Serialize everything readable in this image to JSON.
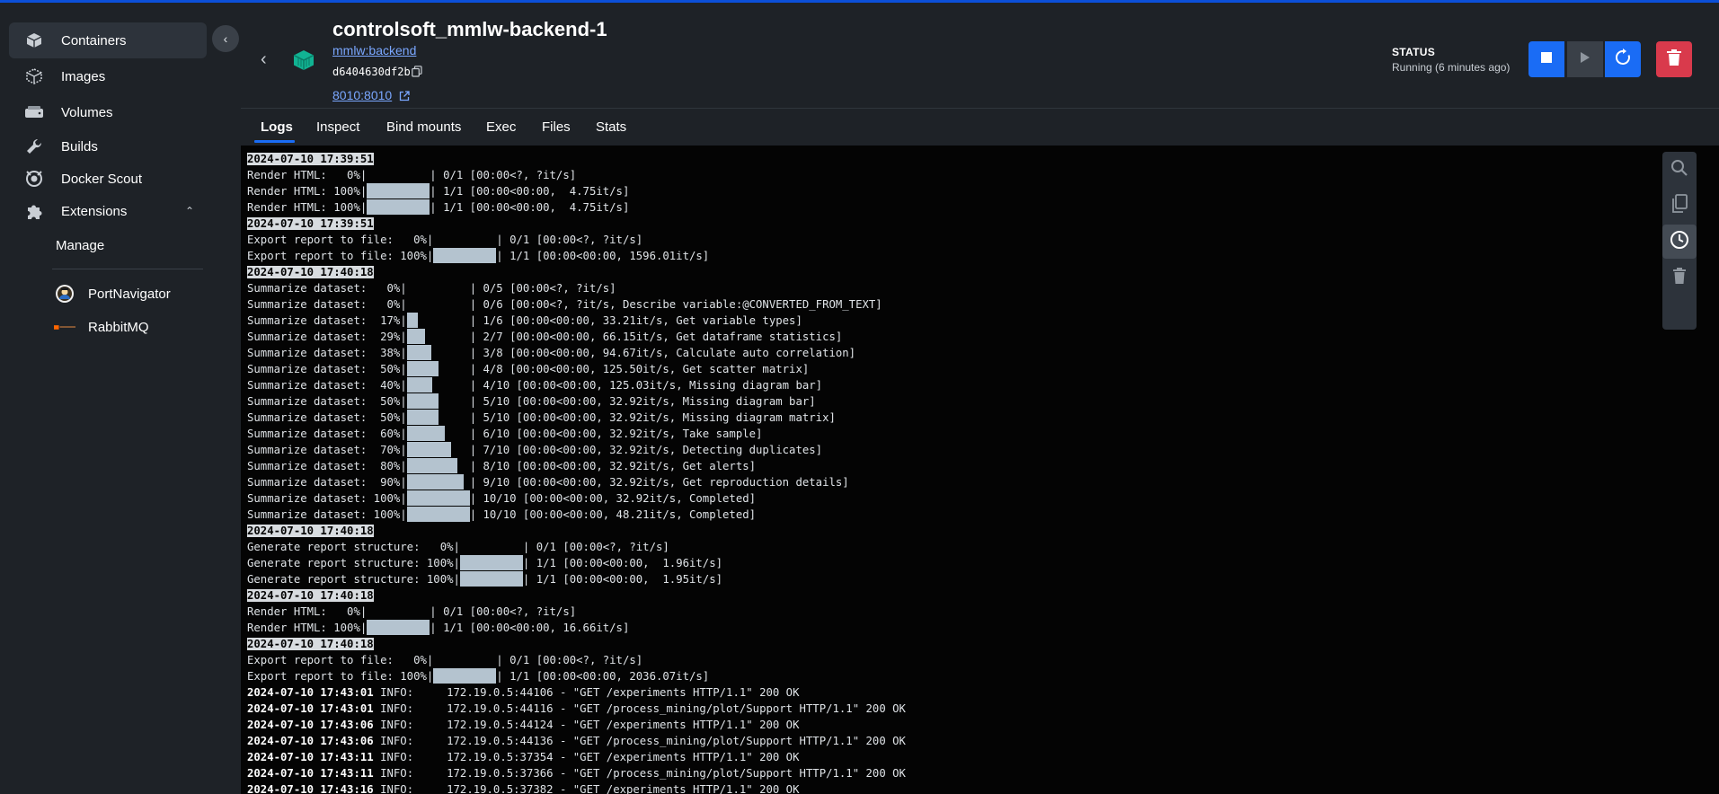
{
  "sidebar": {
    "items": [
      {
        "label": "Containers",
        "icon": "container-icon",
        "active": true
      },
      {
        "label": "Images",
        "icon": "images-icon"
      },
      {
        "label": "Volumes",
        "icon": "volumes-icon"
      },
      {
        "label": "Builds",
        "icon": "builds-icon"
      },
      {
        "label": "Docker Scout",
        "icon": "scout-icon"
      },
      {
        "label": "Extensions",
        "icon": "extensions-icon"
      }
    ],
    "manage_label": "Manage",
    "extensions": [
      {
        "label": "PortNavigator",
        "icon": "portnavigator-icon"
      },
      {
        "label": "RabbitMQ",
        "icon": "rabbitmq-icon"
      }
    ]
  },
  "container": {
    "name": "controlsoft_mmlw-backend-1",
    "image": "mmlw:backend",
    "id": "d6404630df2b",
    "port": "8010:8010",
    "status_label": "STATUS",
    "status_value": "Running (6 minutes ago)"
  },
  "tabs": [
    "Logs",
    "Inspect",
    "Bind mounts",
    "Exec",
    "Files",
    "Stats"
  ],
  "colors": {
    "accent": "#1a6cf5",
    "danger": "#d93a4c",
    "link": "#7aa7ff"
  },
  "logs": [
    {
      "ts": "2024-07-10 17:39:51"
    },
    {
      "pre": "Render HTML:   0%|",
      "bar": 0,
      "post": "| 0/1 [00:00<?, ?it/s]"
    },
    {
      "pre": "Render HTML: 100%|",
      "bar": 1,
      "post": "| 1/1 [00:00<00:00,  4.75it/s]"
    },
    {
      "pre": "Render HTML: 100%|",
      "bar": 1,
      "post": "| 1/1 [00:00<00:00,  4.75it/s]"
    },
    {
      "ts": "2024-07-10 17:39:51"
    },
    {
      "pre": "Export report to file:   0%|",
      "bar": 0,
      "post": "| 0/1 [00:00<?, ?it/s]"
    },
    {
      "pre": "Export report to file: 100%|",
      "bar": 1,
      "post": "| 1/1 [00:00<00:00, 1596.01it/s]"
    },
    {
      "ts": "2024-07-10 17:40:18"
    },
    {
      "pre": "Summarize dataset:   0%|",
      "bar": 0,
      "post": "| 0/5 [00:00<?, ?it/s]"
    },
    {
      "pre": "Summarize dataset:   0%|",
      "bar": 0,
      "post": "| 0/6 [00:00<?, ?it/s, Describe variable:@CONVERTED_FROM_TEXT]"
    },
    {
      "pre": "Summarize dataset:  17%|",
      "bar": 0.17,
      "post": "| 1/6 [00:00<00:00, 33.21it/s, Get variable types]"
    },
    {
      "pre": "Summarize dataset:  29%|",
      "bar": 0.29,
      "post": "| 2/7 [00:00<00:00, 66.15it/s, Get dataframe statistics]"
    },
    {
      "pre": "Summarize dataset:  38%|",
      "bar": 0.38,
      "post": "| 3/8 [00:00<00:00, 94.67it/s, Calculate auto correlation]"
    },
    {
      "pre": "Summarize dataset:  50%|",
      "bar": 0.5,
      "post": "| 4/8 [00:00<00:00, 125.50it/s, Get scatter matrix]"
    },
    {
      "pre": "Summarize dataset:  40%|",
      "bar": 0.4,
      "post": "| 4/10 [00:00<00:00, 125.03it/s, Missing diagram bar]"
    },
    {
      "pre": "Summarize dataset:  50%|",
      "bar": 0.5,
      "post": "| 5/10 [00:00<00:00, 32.92it/s, Missing diagram bar]"
    },
    {
      "pre": "Summarize dataset:  50%|",
      "bar": 0.5,
      "post": "| 5/10 [00:00<00:00, 32.92it/s, Missing diagram matrix]"
    },
    {
      "pre": "Summarize dataset:  60%|",
      "bar": 0.6,
      "post": "| 6/10 [00:00<00:00, 32.92it/s, Take sample]"
    },
    {
      "pre": "Summarize dataset:  70%|",
      "bar": 0.7,
      "post": "| 7/10 [00:00<00:00, 32.92it/s, Detecting duplicates]"
    },
    {
      "pre": "Summarize dataset:  80%|",
      "bar": 0.8,
      "post": "| 8/10 [00:00<00:00, 32.92it/s, Get alerts]"
    },
    {
      "pre": "Summarize dataset:  90%|",
      "bar": 0.9,
      "post": "| 9/10 [00:00<00:00, 32.92it/s, Get reproduction details]"
    },
    {
      "pre": "Summarize dataset: 100%|",
      "bar": 1,
      "post": "| 10/10 [00:00<00:00, 32.92it/s, Completed]"
    },
    {
      "pre": "Summarize dataset: 100%|",
      "bar": 1,
      "post": "| 10/10 [00:00<00:00, 48.21it/s, Completed]"
    },
    {
      "ts": "2024-07-10 17:40:18"
    },
    {
      "pre": "Generate report structure:   0%|",
      "bar": 0,
      "post": "| 0/1 [00:00<?, ?it/s]"
    },
    {
      "pre": "Generate report structure: 100%|",
      "bar": 1,
      "post": "| 1/1 [00:00<00:00,  1.96it/s]"
    },
    {
      "pre": "Generate report structure: 100%|",
      "bar": 1,
      "post": "| 1/1 [00:00<00:00,  1.95it/s]"
    },
    {
      "ts": "2024-07-10 17:40:18"
    },
    {
      "pre": "Render HTML:   0%|",
      "bar": 0,
      "post": "| 0/1 [00:00<?, ?it/s]"
    },
    {
      "pre": "Render HTML: 100%|",
      "bar": 1,
      "post": "| 1/1 [00:00<00:00, 16.66it/s]"
    },
    {
      "ts": "2024-07-10 17:40:18"
    },
    {
      "pre": "Export report to file:   0%|",
      "bar": 0,
      "post": "| 0/1 [00:00<?, ?it/s]"
    },
    {
      "pre": "Export report to file: 100%|",
      "bar": 1,
      "post": "| 1/1 [00:00<00:00, 2036.07it/s]"
    },
    {
      "tsi": "2024-07-10 17:43:01",
      "msg": " INFO:     172.19.0.5:44106 - \"GET /experiments HTTP/1.1\" 200 OK"
    },
    {
      "tsi": "2024-07-10 17:43:01",
      "msg": " INFO:     172.19.0.5:44116 - \"GET /process_mining/plot/Support HTTP/1.1\" 200 OK"
    },
    {
      "tsi": "2024-07-10 17:43:06",
      "msg": " INFO:     172.19.0.5:44124 - \"GET /experiments HTTP/1.1\" 200 OK"
    },
    {
      "tsi": "2024-07-10 17:43:06",
      "msg": " INFO:     172.19.0.5:44136 - \"GET /process_mining/plot/Support HTTP/1.1\" 200 OK"
    },
    {
      "tsi": "2024-07-10 17:43:11",
      "msg": " INFO:     172.19.0.5:37354 - \"GET /experiments HTTP/1.1\" 200 OK"
    },
    {
      "tsi": "2024-07-10 17:43:11",
      "msg": " INFO:     172.19.0.5:37366 - \"GET /process_mining/plot/Support HTTP/1.1\" 200 OK"
    },
    {
      "tsi": "2024-07-10 17:43:16",
      "msg": " INFO:     172.19.0.5:37382 - \"GET /experiments HTTP/1.1\" 200 OK"
    }
  ]
}
